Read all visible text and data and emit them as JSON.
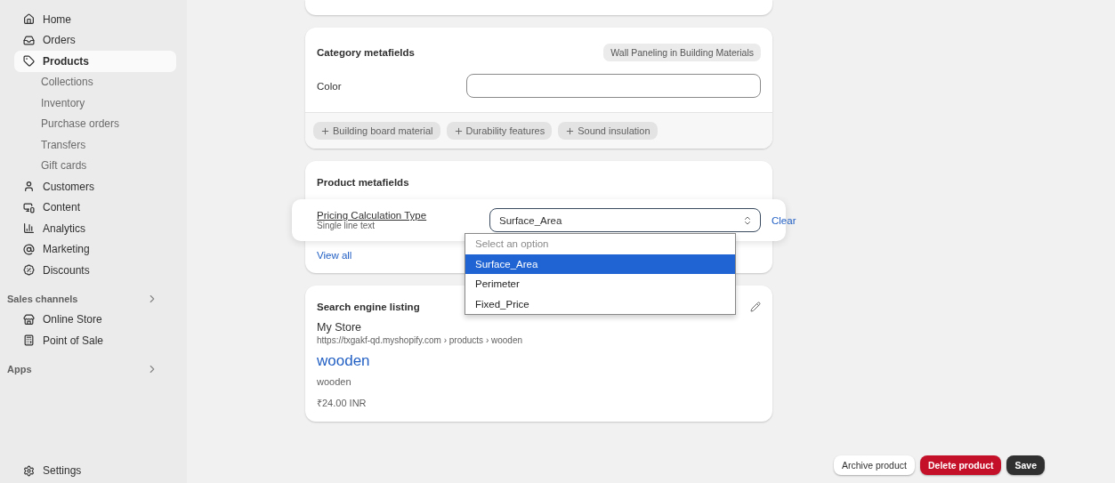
{
  "sidebar": {
    "items": [
      {
        "label": "Home",
        "kind": "main",
        "selected": false
      },
      {
        "label": "Orders",
        "kind": "main",
        "selected": false
      },
      {
        "label": "Products",
        "kind": "main",
        "selected": true
      },
      {
        "label": "Collections",
        "kind": "sub",
        "selected": false
      },
      {
        "label": "Inventory",
        "kind": "sub",
        "selected": false
      },
      {
        "label": "Purchase orders",
        "kind": "sub",
        "selected": false
      },
      {
        "label": "Transfers",
        "kind": "sub",
        "selected": false
      },
      {
        "label": "Gift cards",
        "kind": "sub",
        "selected": false
      },
      {
        "label": "Customers",
        "kind": "main",
        "selected": false
      },
      {
        "label": "Content",
        "kind": "main",
        "selected": false
      },
      {
        "label": "Analytics",
        "kind": "main",
        "selected": false
      },
      {
        "label": "Marketing",
        "kind": "main",
        "selected": false
      },
      {
        "label": "Discounts",
        "kind": "main",
        "selected": false
      },
      {
        "label": "Sales channels",
        "kind": "section"
      },
      {
        "label": "Online Store",
        "kind": "main",
        "selected": false
      },
      {
        "label": "Point of Sale",
        "kind": "main",
        "selected": false
      },
      {
        "label": "Apps",
        "kind": "section"
      }
    ],
    "settings": "Settings"
  },
  "category_metafields": {
    "title": "Category metafields",
    "category": "Wall Paneling in Building Materials",
    "fields": [
      {
        "label": "Color"
      }
    ],
    "suggestions": [
      "Building board material",
      "Durability features",
      "Sound insulation"
    ]
  },
  "product_metafields": {
    "title": "Product metafields",
    "field": {
      "label": "Pricing Calculation Type",
      "type": "Single line text",
      "value": "Surface_Area",
      "clear": "Clear"
    },
    "dropdown": {
      "expanded": true,
      "options": [
        {
          "label": "Select an option",
          "kind": "placeholder",
          "selected": false
        },
        {
          "label": "Surface_Area",
          "kind": "option",
          "selected": true
        },
        {
          "label": "Perimeter",
          "kind": "option",
          "selected": false
        },
        {
          "label": "Fixed_Price",
          "kind": "option",
          "selected": false
        }
      ]
    },
    "view_all": "View all"
  },
  "search_listing": {
    "title": "Search engine listing",
    "store": "My Store",
    "url": "https://txgakf-qd.myshopify.com › products › wooden",
    "page_title": "wooden",
    "description": "wooden",
    "price": "₹24.00 INR"
  },
  "actions": [
    {
      "label": "Archive product",
      "kind": "secondary"
    },
    {
      "label": "Delete product",
      "kind": "danger"
    },
    {
      "label": "Save",
      "kind": "primary"
    }
  ]
}
